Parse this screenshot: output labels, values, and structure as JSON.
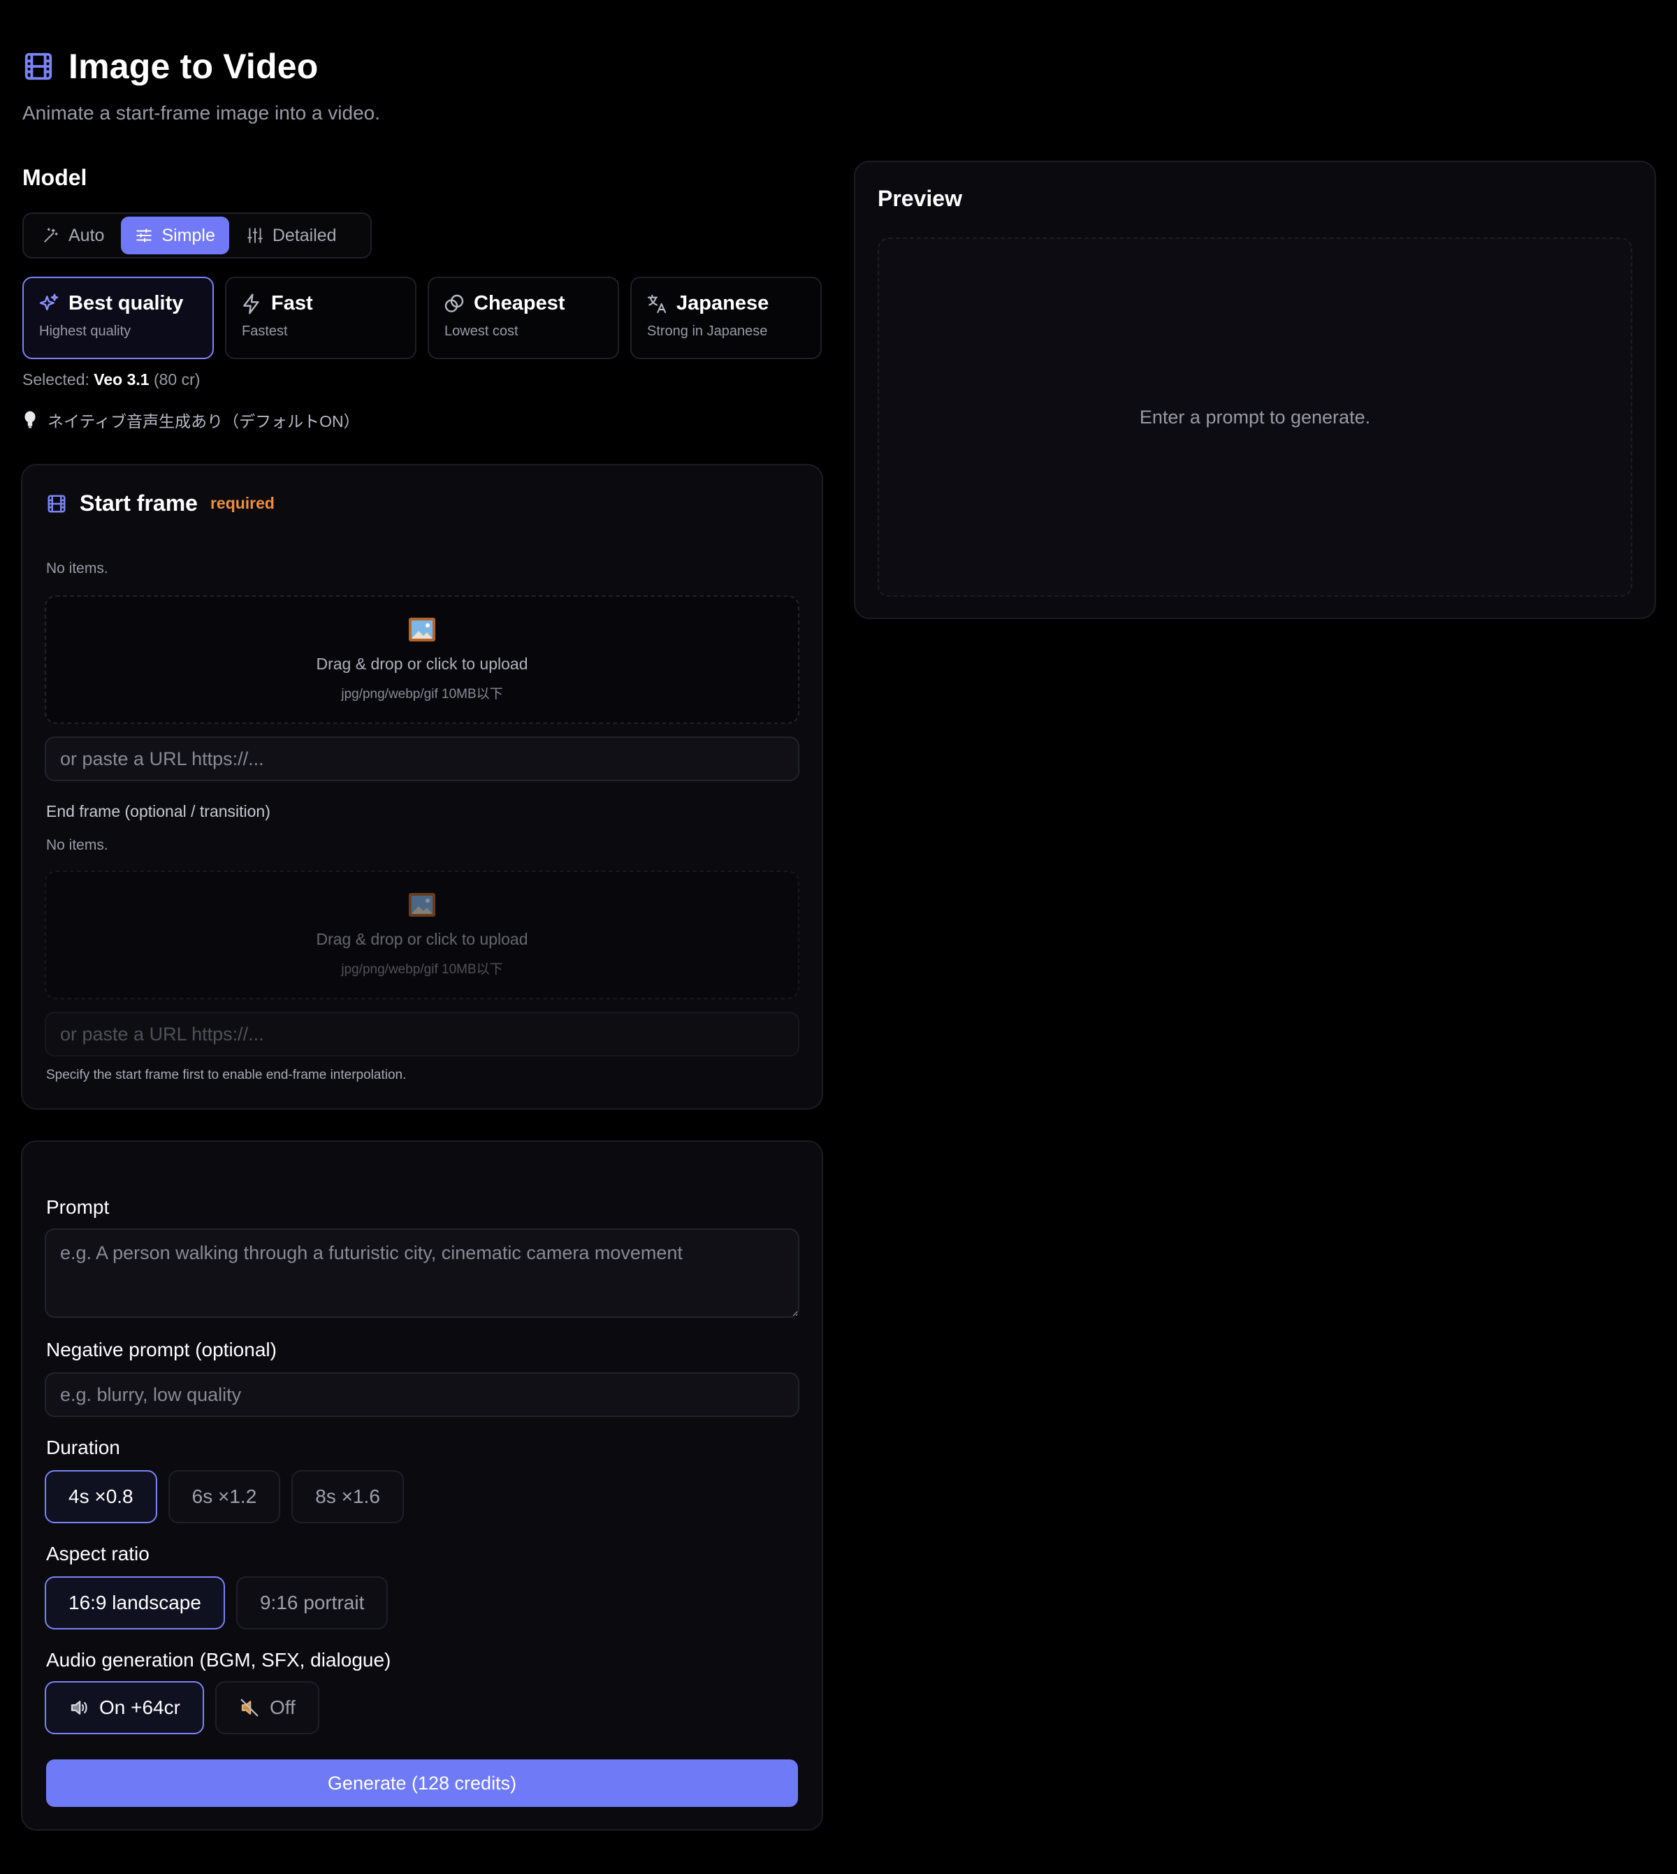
{
  "header": {
    "title": "Image to Video",
    "subtitle": "Animate a start-frame image into a video."
  },
  "model": {
    "label": "Model",
    "modes": [
      {
        "label": "Auto",
        "icon": "magic-wand-icon",
        "active": false
      },
      {
        "label": "Simple",
        "icon": "sliders-icon",
        "active": true
      },
      {
        "label": "Detailed",
        "icon": "vertical-sliders-icon",
        "active": false
      }
    ],
    "cards": [
      {
        "name": "Best quality",
        "desc": "Highest quality",
        "icon": "sparkles-icon",
        "active": true
      },
      {
        "name": "Fast",
        "desc": "Fastest",
        "icon": "lightning-icon",
        "active": false
      },
      {
        "name": "Cheapest",
        "desc": "Lowest cost",
        "icon": "coins-icon",
        "active": false
      },
      {
        "name": "Japanese",
        "desc": "Strong in Japanese",
        "icon": "translate-icon",
        "active": false
      }
    ],
    "selected_prefix": "Selected: ",
    "selected_model": "Veo 3.1",
    "selected_cost": " (80 cr)",
    "tip": "ネイティブ音声生成あり（デフォルトON）"
  },
  "start_frame": {
    "title": "Start frame",
    "required": "required",
    "no_items": "No items.",
    "dropzone_main": "Drag & drop or click to upload",
    "dropzone_sub": "jpg/png/webp/gif 10MB以下",
    "url_placeholder": "or paste a URL https://..."
  },
  "end_frame": {
    "label": "End frame (optional / transition)",
    "no_items": "No items.",
    "dropzone_main": "Drag & drop or click to upload",
    "dropzone_sub": "jpg/png/webp/gif 10MB以下",
    "url_placeholder": "or paste a URL https://...",
    "hint": "Specify the start frame first to enable end-frame interpolation."
  },
  "form": {
    "prompt_label": "Prompt",
    "prompt_placeholder": "e.g. A person walking through a futuristic city, cinematic camera movement",
    "negative_label": "Negative prompt (optional)",
    "negative_placeholder": "e.g. blurry, low quality",
    "duration_label": "Duration",
    "durations": [
      {
        "label": "4s ×0.8",
        "active": true
      },
      {
        "label": "6s ×1.2",
        "active": false
      },
      {
        "label": "8s ×1.6",
        "active": false
      }
    ],
    "aspect_label": "Aspect ratio",
    "aspects": [
      {
        "label": "16:9 landscape",
        "active": true
      },
      {
        "label": "9:16 portrait",
        "active": false
      }
    ],
    "audio_label": "Audio generation (BGM, SFX, dialogue)",
    "audio_options": [
      {
        "label": "On +64cr",
        "icon": "speaker-on-icon",
        "active": true
      },
      {
        "label": "Off",
        "icon": "speaker-off-icon",
        "active": false
      }
    ],
    "generate_label": "Generate (128 credits)"
  },
  "preview": {
    "title": "Preview",
    "empty": "Enter a prompt to generate."
  },
  "colors": {
    "accent": "#7179f6",
    "background": "#000000",
    "panel": "#0a0a0f",
    "required": "#f08d3c"
  }
}
